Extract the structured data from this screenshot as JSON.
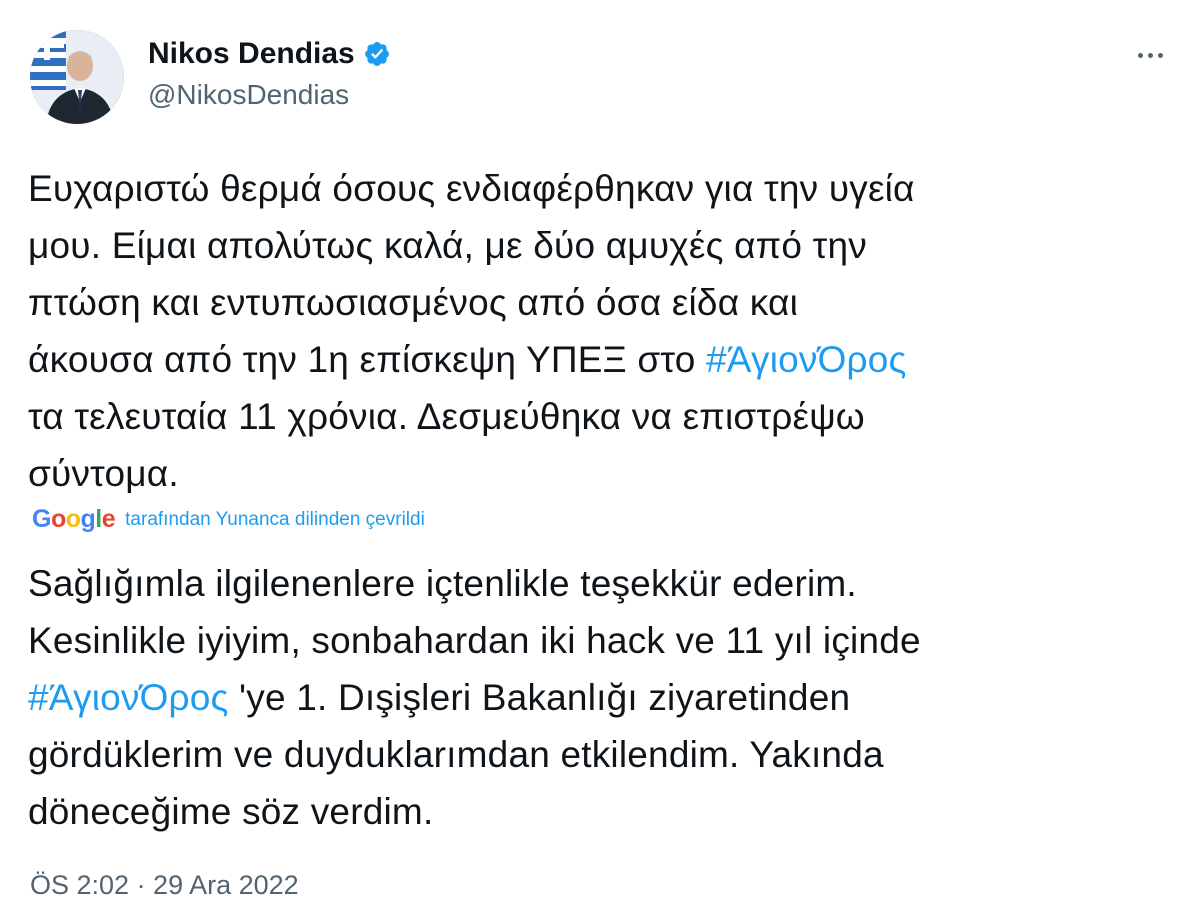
{
  "author": {
    "display_name": "Nikos Dendias",
    "handle": "@NikosDendias",
    "verified": true
  },
  "tweet": {
    "original_lines": [
      "Ευχαριστώ θερμά όσους ενδιαφέρθηκαν για την υγεία",
      "μου. Είμαι απολύτως καλά, με δύο αμυχές από την",
      "πτώση και εντυπωσιασμένος από όσα είδα και",
      "άκουσα από την 1η επίσκεψη ΥΠΕΞ στο ",
      "τα τελευταία 11 χρόνια. Δεσμεύθηκα να επιστρέψω",
      "σύντομα."
    ],
    "hashtag": "#ΆγιονΌρος",
    "translation_attribution": {
      "provider_logo": "Google",
      "label": "tarafından Yunanca dilinden çevrildi"
    },
    "translated_lines": [
      "Sağlığımla ilgilenenlere içtenlikle teşekkür ederim.",
      "Kesinlikle iyiyim, sonbahardan iki hack ve 11 yıl içinde",
      " 'ye 1. Dışişleri Bakanlığı ziyaretinden",
      "gördüklerim ve duyduklarımdan etkilendim. Yakında",
      "döneceğime söz verdim."
    ],
    "timestamp": "ÖS 2:02 · 29 Ara 2022"
  },
  "icons": {
    "verified": "verified-badge-icon",
    "more": "more-options-icon"
  },
  "colors": {
    "link": "#1d9bf0",
    "secondary_text": "#536471",
    "primary_text": "#0f1419",
    "google_blue": "#4285F4",
    "google_red": "#EA4335",
    "google_yellow": "#FBBC05",
    "google_green": "#34A853"
  }
}
